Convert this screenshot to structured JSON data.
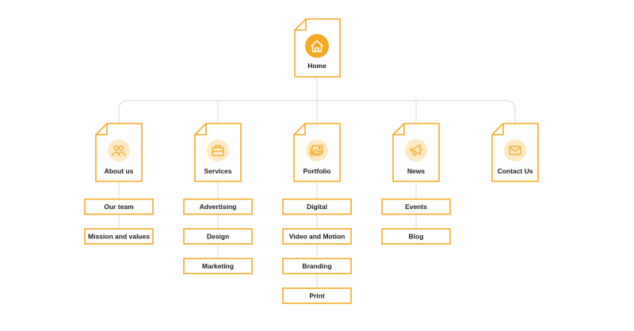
{
  "sitemap": {
    "accent_color": "#f7a823",
    "accent_light": "#fde9c4",
    "connector_color": "#d9d9d9",
    "home": {
      "label": "Home",
      "icon": "home-icon"
    },
    "sections": [
      {
        "label": "About us",
        "icon": "team-icon",
        "children": [
          "Our team",
          "Mission and values"
        ]
      },
      {
        "label": "Services",
        "icon": "briefcase-icon",
        "children": [
          "Advertising",
          "Design",
          "Marketing"
        ]
      },
      {
        "label": "Portfolio",
        "icon": "image-icon",
        "children": [
          "Digital",
          "Video and Motion",
          "Branding",
          "Print"
        ]
      },
      {
        "label": "News",
        "icon": "megaphone-icon",
        "children": [
          "Events",
          "Blog"
        ]
      },
      {
        "label": "Contact Us",
        "icon": "mail-icon",
        "children": []
      }
    ]
  }
}
